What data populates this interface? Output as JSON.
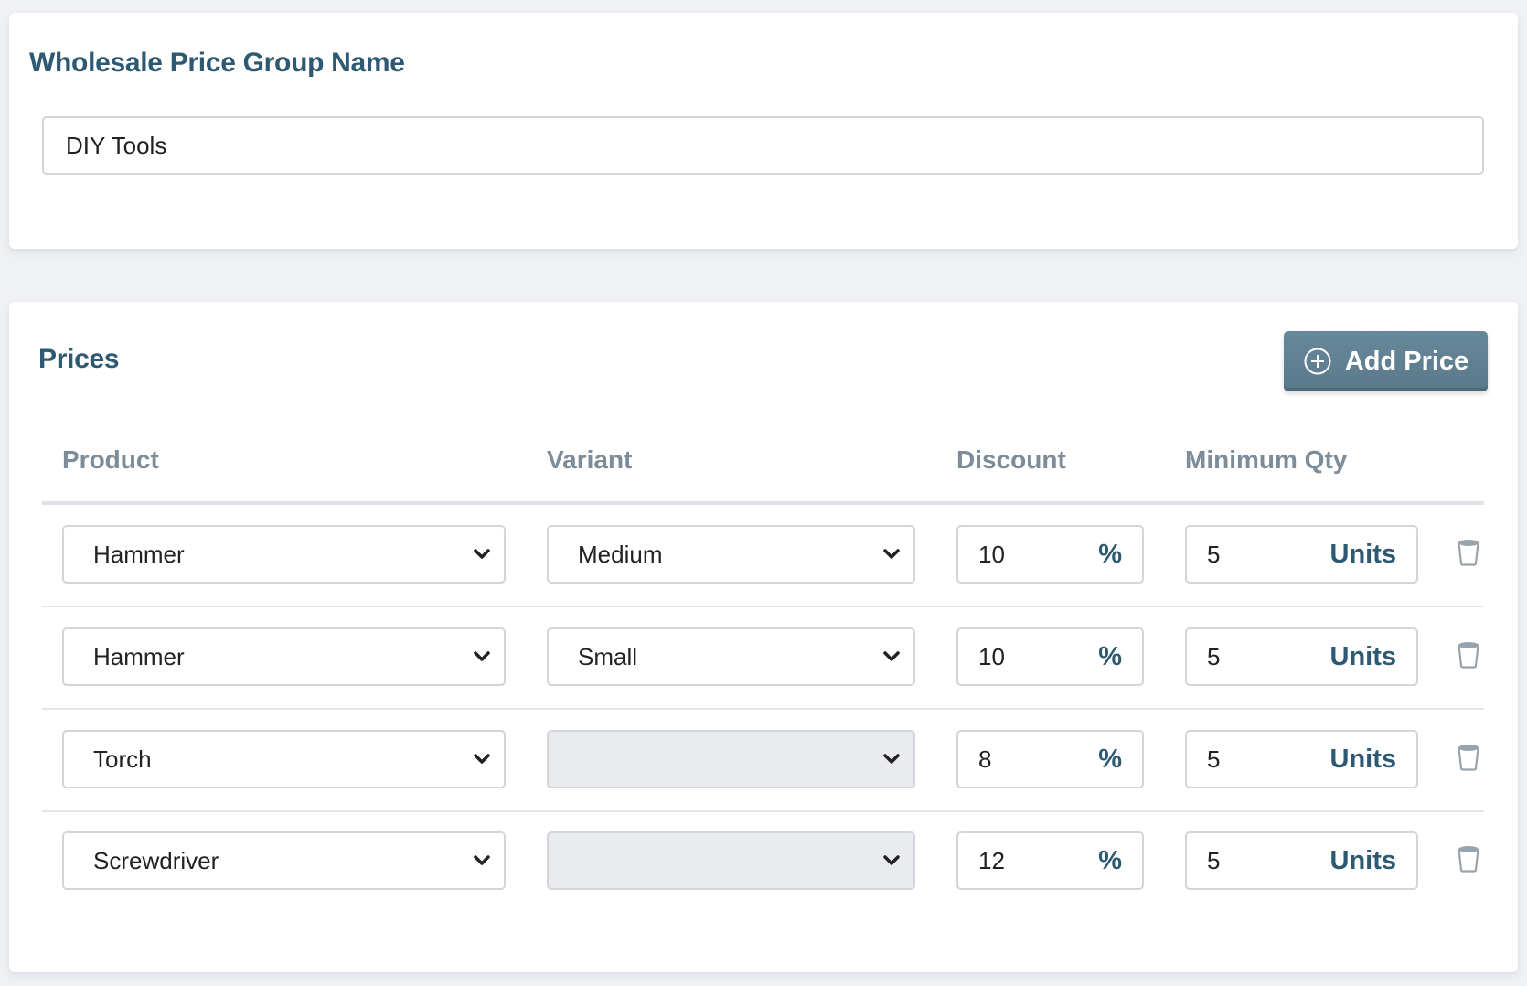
{
  "group_name_card": {
    "title": "Wholesale Price Group Name",
    "input_value": "DIY Tools"
  },
  "prices_card": {
    "title": "Prices",
    "add_button_label": "Add Price",
    "add_button_icon": "plus-circle-icon",
    "columns": [
      "Product",
      "Variant",
      "Discount",
      "Minimum Qty"
    ],
    "rows": [
      {
        "product": "Hammer",
        "variant": "Medium",
        "variant_disabled": false,
        "discount": "10",
        "discount_suffix": "%",
        "min_qty": "5",
        "min_qty_suffix": "Units"
      },
      {
        "product": "Hammer",
        "variant": "Small",
        "variant_disabled": false,
        "discount": "10",
        "discount_suffix": "%",
        "min_qty": "5",
        "min_qty_suffix": "Units"
      },
      {
        "product": "Torch",
        "variant": "",
        "variant_disabled": true,
        "discount": "8",
        "discount_suffix": "%",
        "min_qty": "5",
        "min_qty_suffix": "Units"
      },
      {
        "product": "Screwdriver",
        "variant": "",
        "variant_disabled": true,
        "discount": "12",
        "discount_suffix": "%",
        "min_qty": "5",
        "min_qty_suffix": "Units"
      }
    ],
    "row_action_icon": "trash-icon"
  },
  "colors": {
    "heading": "#2d5a72",
    "column_header": "#7d8c99",
    "button_bg": "#5f7f91",
    "page_bg": "#eff1f5"
  }
}
